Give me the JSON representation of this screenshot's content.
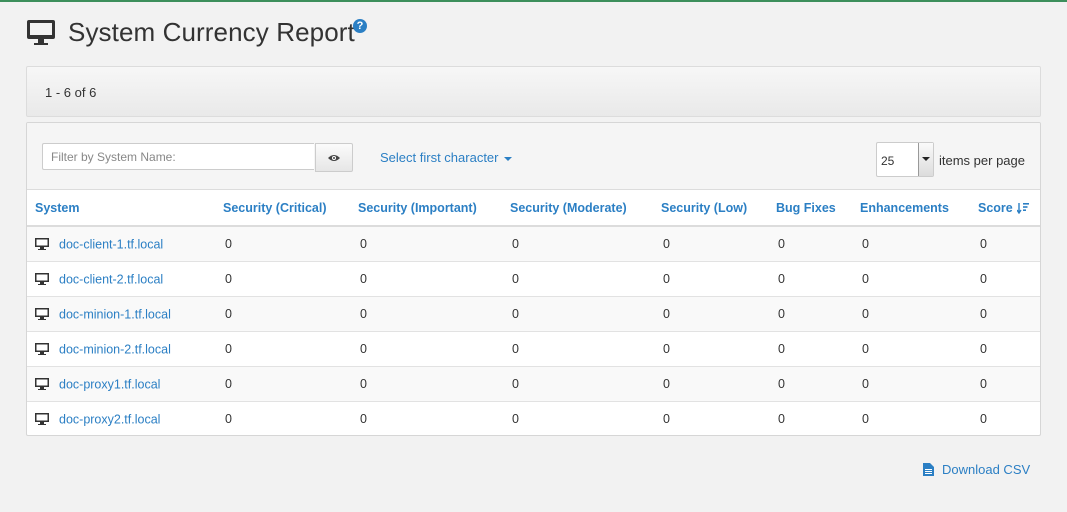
{
  "page": {
    "title": "System Currency Report",
    "help_icon": "question-circle-icon",
    "title_icon": "desktop-monitor-icon",
    "accent_color": "#2b7fc4",
    "top_border_color": "#3d8f5c"
  },
  "pagination": {
    "summary": "1 - 6 of 6"
  },
  "toolbar": {
    "filter_placeholder": "Filter by System Name:",
    "filter_value": "",
    "filter_button_icon": "eye-icon",
    "select_first_character": "Select first character",
    "per_page_value": "25",
    "per_page_label": "items per page"
  },
  "table": {
    "columns": [
      "System",
      "Security (Critical)",
      "Security (Important)",
      "Security (Moderate)",
      "Security (Low)",
      "Bug Fixes",
      "Enhancements",
      "Score"
    ],
    "sorted_column": "Score",
    "sort_icon": "sort-descending-icon",
    "row_icon": "desktop-system-icon",
    "rows": [
      {
        "system": "doc-client-1.tf.local",
        "critical": "0",
        "important": "0",
        "moderate": "0",
        "low": "0",
        "bugfixes": "0",
        "enhancements": "0",
        "score": "0"
      },
      {
        "system": "doc-client-2.tf.local",
        "critical": "0",
        "important": "0",
        "moderate": "0",
        "low": "0",
        "bugfixes": "0",
        "enhancements": "0",
        "score": "0"
      },
      {
        "system": "doc-minion-1.tf.local",
        "critical": "0",
        "important": "0",
        "moderate": "0",
        "low": "0",
        "bugfixes": "0",
        "enhancements": "0",
        "score": "0"
      },
      {
        "system": "doc-minion-2.tf.local",
        "critical": "0",
        "important": "0",
        "moderate": "0",
        "low": "0",
        "bugfixes": "0",
        "enhancements": "0",
        "score": "0"
      },
      {
        "system": "doc-proxy1.tf.local",
        "critical": "0",
        "important": "0",
        "moderate": "0",
        "low": "0",
        "bugfixes": "0",
        "enhancements": "0",
        "score": "0"
      },
      {
        "system": "doc-proxy2.tf.local",
        "critical": "0",
        "important": "0",
        "moderate": "0",
        "low": "0",
        "bugfixes": "0",
        "enhancements": "0",
        "score": "0"
      }
    ]
  },
  "footer": {
    "download_label": "Download CSV",
    "download_icon": "file-csv-icon"
  }
}
